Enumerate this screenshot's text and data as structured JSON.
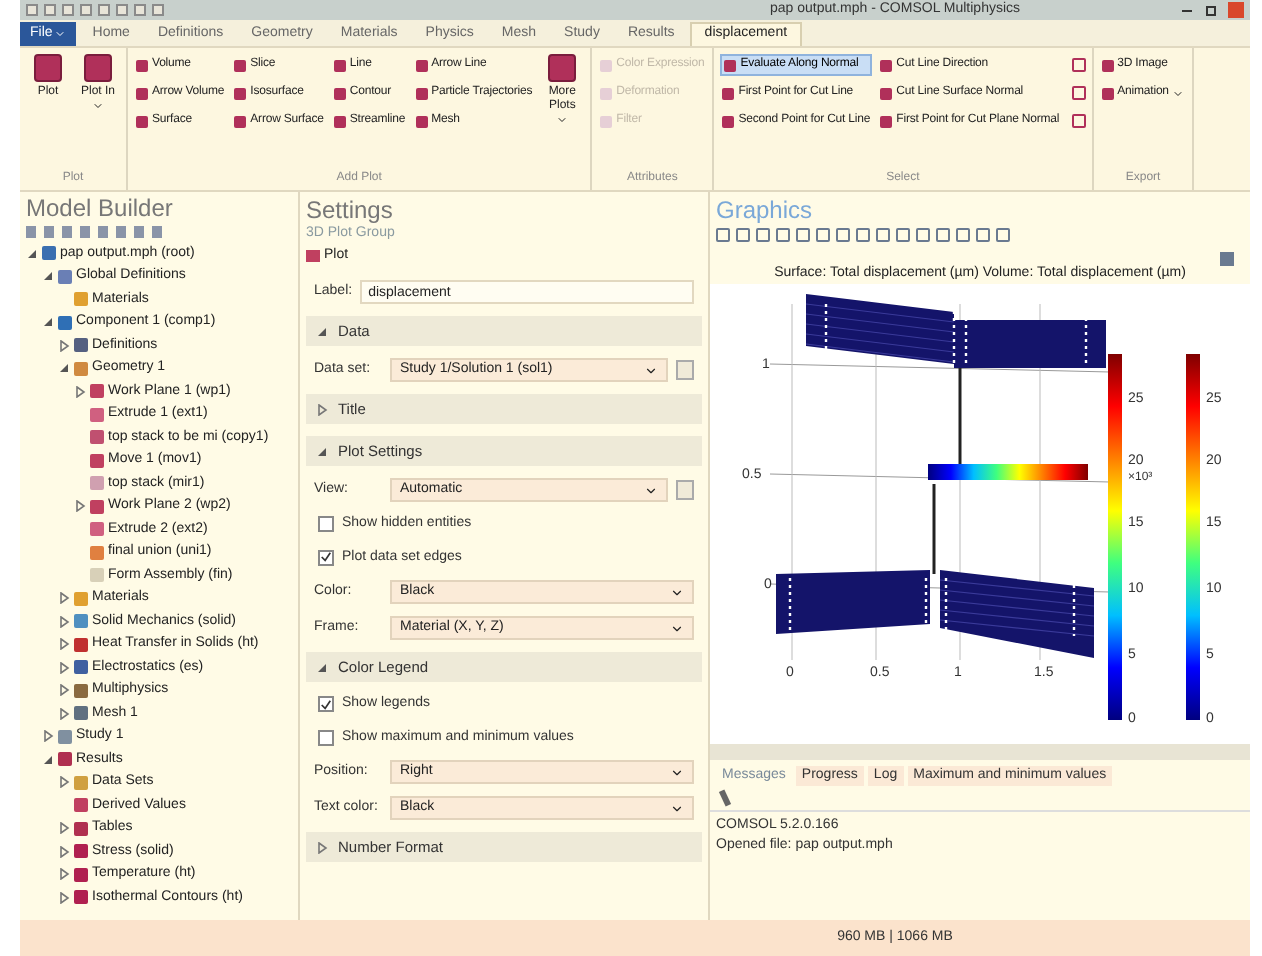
{
  "window": {
    "title": "pap output.mph - COMSOL Multiphysics"
  },
  "file_menu": "File",
  "ribbon_tabs": [
    {
      "label": "Home",
      "selected": false
    },
    {
      "label": "Definitions",
      "selected": false
    },
    {
      "label": "Geometry",
      "selected": false
    },
    {
      "label": "Materials",
      "selected": false
    },
    {
      "label": "Physics",
      "selected": false
    },
    {
      "label": "Mesh",
      "selected": false
    },
    {
      "label": "Study",
      "selected": false
    },
    {
      "label": "Results",
      "selected": false
    },
    {
      "label": "displacement",
      "selected": true
    }
  ],
  "ribbon_groups": [
    {
      "label": "Plot",
      "items": [
        {
          "kind": "large",
          "label": "Plot",
          "dropdown": false
        },
        {
          "kind": "large",
          "label": "Plot In",
          "dropdown": true
        }
      ]
    },
    {
      "label": "Add Plot",
      "items": [
        {
          "kind": "small",
          "label": "Volume"
        },
        {
          "kind": "small",
          "label": "Arrow Volume"
        },
        {
          "kind": "small",
          "label": "Surface"
        },
        {
          "kind": "small",
          "label": "Slice"
        },
        {
          "kind": "small",
          "label": "Isosurface"
        },
        {
          "kind": "small",
          "label": "Arrow Surface"
        },
        {
          "kind": "small",
          "label": "Line"
        },
        {
          "kind": "small",
          "label": "Contour"
        },
        {
          "kind": "small",
          "label": "Streamline"
        },
        {
          "kind": "small",
          "label": "Arrow Line"
        },
        {
          "kind": "small",
          "label": "Particle Trajectories"
        },
        {
          "kind": "small",
          "label": "Mesh"
        },
        {
          "kind": "large",
          "label": "More Plots",
          "dropdown": true
        }
      ]
    },
    {
      "label": "Attributes",
      "items": [
        {
          "kind": "small",
          "label": "Color Expression",
          "disabled": true
        },
        {
          "kind": "small",
          "label": "Deformation",
          "disabled": true
        },
        {
          "kind": "small",
          "label": "Filter",
          "disabled": true
        }
      ]
    },
    {
      "label": "Select",
      "items": [
        {
          "kind": "small",
          "label": "Evaluate Along Normal",
          "selected": true
        },
        {
          "kind": "small",
          "label": "First Point for Cut Line",
          "selected": false
        },
        {
          "kind": "small",
          "label": "Second Point for Cut Line",
          "selected": false
        },
        {
          "kind": "small",
          "label": "Cut Line Direction",
          "selected": false
        },
        {
          "kind": "small",
          "label": "Cut Line Surface Normal",
          "selected": false
        },
        {
          "kind": "small",
          "label": "First Point for Cut Plane Normal",
          "selected": false
        },
        {
          "kind": "icon"
        },
        {
          "kind": "icon"
        },
        {
          "kind": "icon"
        }
      ]
    },
    {
      "label": "Export",
      "items": [
        {
          "kind": "small",
          "label": "3D Image"
        },
        {
          "kind": "small",
          "label": "Animation",
          "dropdown": true
        }
      ]
    }
  ],
  "model_builder": {
    "title": "Model Builder",
    "tree": [
      {
        "label": "pap output.mph (root)",
        "color": "#3b6fb0",
        "expanded": true,
        "children": [
          {
            "label": "Global Definitions",
            "color": "#6a7fb5",
            "expanded": true,
            "children": [
              {
                "label": "Materials",
                "color": "#e0a030"
              }
            ]
          },
          {
            "label": "Component 1 (comp1)",
            "color": "#2f6fb5",
            "expanded": true,
            "children": [
              {
                "label": "Definitions",
                "color": "#556080",
                "expanded": false
              },
              {
                "label": "Geometry 1",
                "color": "#d08a40",
                "expanded": true,
                "children": [
                  {
                    "label": "Work Plane 1 (wp1)",
                    "color": "#c04060",
                    "expanded": false
                  },
                  {
                    "label": "Extrude 1 (ext1)",
                    "color": "#d06080"
                  },
                  {
                    "label": "top stack to be mi (copy1)",
                    "color": "#c05070"
                  },
                  {
                    "label": "Move 1 (mov1)",
                    "color": "#c04060"
                  },
                  {
                    "label": "top stack (mir1)",
                    "color": "#d0a0b0"
                  },
                  {
                    "label": "Work Plane 2 (wp2)",
                    "color": "#c04060",
                    "expanded": false
                  },
                  {
                    "label": "Extrude 2 (ext2)",
                    "color": "#d06080"
                  },
                  {
                    "label": "final union (uni1)",
                    "color": "#e08040"
                  },
                  {
                    "label": "Form Assembly (fin)",
                    "color": "#d8d0b8"
                  }
                ]
              },
              {
                "label": "Materials",
                "color": "#e0a030",
                "expanded": false
              },
              {
                "label": "Solid Mechanics (solid)",
                "color": "#5090c0",
                "expanded": false
              },
              {
                "label": "Heat Transfer in Solids (ht)",
                "color": "#c03030",
                "expanded": false
              },
              {
                "label": "Electrostatics (es)",
                "color": "#4060a0",
                "expanded": false
              },
              {
                "label": "Multiphysics",
                "color": "#8a6a40",
                "expanded": false
              },
              {
                "label": "Mesh 1",
                "color": "#607080",
                "expanded": false
              }
            ]
          },
          {
            "label": "Study 1",
            "color": "#8090a0",
            "expanded": false
          },
          {
            "label": "Results",
            "color": "#b03050",
            "expanded": true,
            "children": [
              {
                "label": "Data Sets",
                "color": "#d0a040",
                "expanded": false
              },
              {
                "label": "Derived Values",
                "color": "#c04060"
              },
              {
                "label": "Tables",
                "color": "#b03050",
                "expanded": false
              },
              {
                "label": "Stress (solid)",
                "color": "#b02050",
                "expanded": false
              },
              {
                "label": "Temperature (ht)",
                "color": "#b02050",
                "expanded": false
              },
              {
                "label": "Isothermal Contours (ht)",
                "color": "#b02050",
                "expanded": false
              }
            ]
          }
        ]
      }
    ]
  },
  "settings": {
    "title": "Settings",
    "subtitle": "3D Plot Group",
    "plot_button": "Plot",
    "label_field": {
      "label": "Label:",
      "value": "displacement"
    },
    "sections": [
      {
        "title": "Data",
        "expanded": true,
        "rows": [
          {
            "kind": "select",
            "label": "Data set:",
            "value": "Study 1/Solution 1 (sol1)",
            "extra": true
          }
        ]
      },
      {
        "title": "Title",
        "expanded": false
      },
      {
        "title": "Plot Settings",
        "expanded": true,
        "rows": [
          {
            "kind": "select",
            "label": "View:",
            "value": "Automatic",
            "extra": true
          },
          {
            "kind": "checkbox",
            "label": "Show hidden entities",
            "checked": false
          },
          {
            "kind": "checkbox",
            "label": "Plot data set edges",
            "checked": true
          },
          {
            "kind": "select",
            "label": "Color:",
            "value": "Black",
            "extra": false
          },
          {
            "kind": "select",
            "label": "Frame:",
            "value": "Material (X, Y, Z)",
            "extra": false
          }
        ]
      },
      {
        "title": "Color Legend",
        "expanded": true,
        "rows": [
          {
            "kind": "checkbox",
            "label": "Show legends",
            "checked": true
          },
          {
            "kind": "checkbox",
            "label": "Show maximum and minimum values",
            "checked": false
          },
          {
            "kind": "select",
            "label": "Position:",
            "value": "Right",
            "extra": false
          },
          {
            "kind": "select",
            "label": "Text color:",
            "value": "Black",
            "extra": false
          }
        ]
      },
      {
        "title": "Number Format",
        "expanded": false
      }
    ]
  },
  "graphics": {
    "title": "Graphics",
    "plot_title": "Surface: Total displacement (µm) Volume: Total displacement (µm)",
    "y_axis_labels": [
      "1",
      "0.5",
      "0"
    ],
    "x_axis_labels": [
      "0",
      "0.5",
      "1",
      "1.5"
    ],
    "colorbar_1": {
      "ticks": [
        "25",
        "20",
        "15",
        "10",
        "5",
        "0"
      ],
      "multiplier": "×10³"
    },
    "colorbar_2": {
      "ticks": [
        "25",
        "20",
        "15",
        "10",
        "5",
        "0"
      ]
    }
  },
  "messages": {
    "tabs": [
      {
        "label": "Messages",
        "selected": true
      },
      {
        "label": "Progress",
        "selected": false
      },
      {
        "label": "Log",
        "selected": false
      },
      {
        "label": "Maximum and minimum values",
        "selected": false
      }
    ],
    "lines": [
      "COMSOL 5.2.0.166",
      "Opened file: pap output.mph"
    ]
  },
  "status_bar": {
    "memory": "960 MB | 1066 MB"
  }
}
